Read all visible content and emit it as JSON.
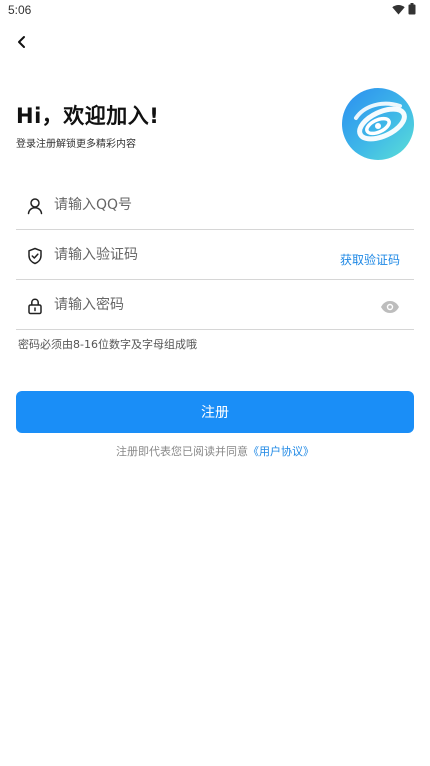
{
  "status_bar": {
    "time": "5:06",
    "icons": [
      "wifi-icon",
      "battery-icon"
    ]
  },
  "nav": {
    "back_icon": "chevron-left-icon"
  },
  "header": {
    "title": "Hi，欢迎加入!",
    "subtitle": "登录注册解锁更多精彩内容",
    "logo_icon": "app-logo-icon"
  },
  "form": {
    "qq": {
      "placeholder": "请输入QQ号",
      "value": "",
      "icon": "user-icon"
    },
    "code": {
      "placeholder": "请输入验证码",
      "value": "",
      "icon": "shield-icon",
      "action_label": "获取验证码"
    },
    "password": {
      "placeholder": "请输入密码",
      "value": "",
      "icon": "lock-icon",
      "toggle_icon": "eye-icon"
    },
    "password_hint": "密码必须由8-16位数字及字母组成哦"
  },
  "actions": {
    "register_label": "注册"
  },
  "agreement": {
    "prefix": "注册即代表您已阅读并同意",
    "link": "《用户协议》"
  },
  "colors": {
    "accent": "#1a8ef7",
    "link": "#1e88e5",
    "divider": "#d6d6d6"
  }
}
